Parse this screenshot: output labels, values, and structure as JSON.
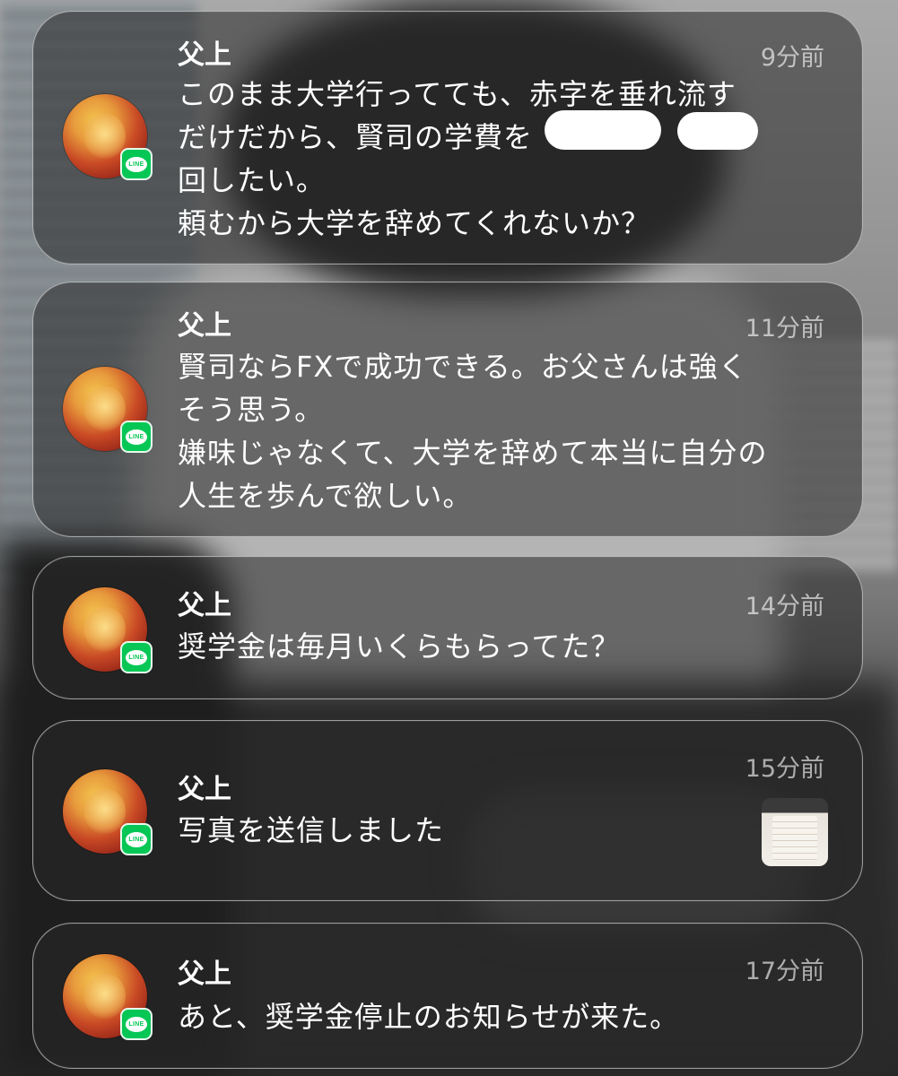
{
  "notifications": [
    {
      "sender": "父上",
      "time": "9分前",
      "message_lines": [
        "このまま大学行ってても、赤字を垂れ流す",
        "だけだから、賢司の学費を　　　や　　に",
        "回したい。",
        "頼むから大学を辞めてくれないか？"
      ],
      "app_badge": "LINE"
    },
    {
      "sender": "父上",
      "time": "11分前",
      "message_lines": [
        "賢司ならFXで成功できる。お父さんは強く",
        "そう思う。",
        "嫌味じゃなくて、大学を辞めて本当に自分の",
        "人生を歩んで欲しい。"
      ],
      "app_badge": "LINE"
    },
    {
      "sender": "父上",
      "time": "14分前",
      "message_lines": [
        "奨学金は毎月いくらもらってた？"
      ],
      "app_badge": "LINE"
    },
    {
      "sender": "父上",
      "time": "15分前",
      "message_lines": [
        "写真を送信しました"
      ],
      "app_badge": "LINE",
      "has_photo_thumbnail": true
    },
    {
      "sender": "父上",
      "time": "17分前",
      "message_lines": [
        "あと、奨学金停止のお知らせが来た。"
      ],
      "app_badge": "LINE"
    }
  ],
  "colors": {
    "line_green": "#06c755",
    "card_bg": "rgba(40,40,40,0.55)",
    "text": "#ffffff",
    "time_text": "rgba(255,255,255,0.62)"
  },
  "icons": {
    "avatar": "apple-portrait-avatar",
    "badge": "line-app-icon"
  }
}
